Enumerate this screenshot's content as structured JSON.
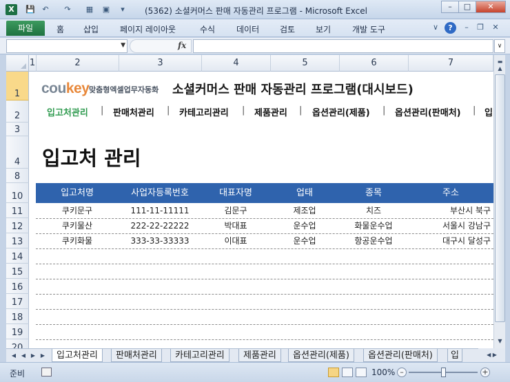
{
  "window": {
    "title": "(5362) 소셜커머스 판매 자동관리 프로그램  -  Microsoft Excel",
    "app_icon": "X"
  },
  "ribbon": {
    "file_tab": "파일",
    "tabs": [
      "홈",
      "삽입",
      "페이지 레이아웃",
      "수식",
      "데이터",
      "검토",
      "보기",
      "개발 도구"
    ]
  },
  "formula_bar": {
    "name_box": "",
    "fx": "fx",
    "formula": ""
  },
  "columns": [
    "1",
    "2",
    "3",
    "4",
    "5",
    "6",
    "7"
  ],
  "rows": [
    "1",
    "2",
    "3",
    "4",
    "8",
    "10",
    "11",
    "12",
    "13",
    "14",
    "15",
    "16",
    "17",
    "18",
    "19",
    "20"
  ],
  "header": {
    "brand_cou": "cou",
    "brand_key": "key",
    "brand_sub": "맞춤형엑셀업무자동화",
    "title": "소셜커머스 판매 자동관리 프로그램(대시보드)"
  },
  "nav": {
    "items": [
      "입고처관리",
      "판매처관리",
      "카테고리관리",
      "제품관리",
      "옵션관리(제품)",
      "옵션관리(판매처)",
      "입"
    ],
    "separator": "|"
  },
  "page_title": "입고처 관리",
  "table": {
    "headers": [
      "입고처명",
      "사업자등록번호",
      "대표자명",
      "업태",
      "종목",
      "주소"
    ],
    "rows": [
      [
        "쿠키문구",
        "111-11-11111",
        "김문구",
        "제조업",
        "치즈",
        "부산시 북구"
      ],
      [
        "쿠키물산",
        "222-22-22222",
        "박대표",
        "운수업",
        "화물운수업",
        "서울시 강남구"
      ],
      [
        "쿠키화물",
        "333-33-33333",
        "이대표",
        "운수업",
        "항공운수업",
        "대구시 달성구"
      ]
    ]
  },
  "sheet_tabs": [
    "입고처관리",
    "판매처관리",
    "카테고리관리",
    "제품관리",
    "옵션관리(제품)",
    "옵션관리(판매처)",
    "입"
  ],
  "status": {
    "ready": "준비",
    "zoom": "100%"
  }
}
